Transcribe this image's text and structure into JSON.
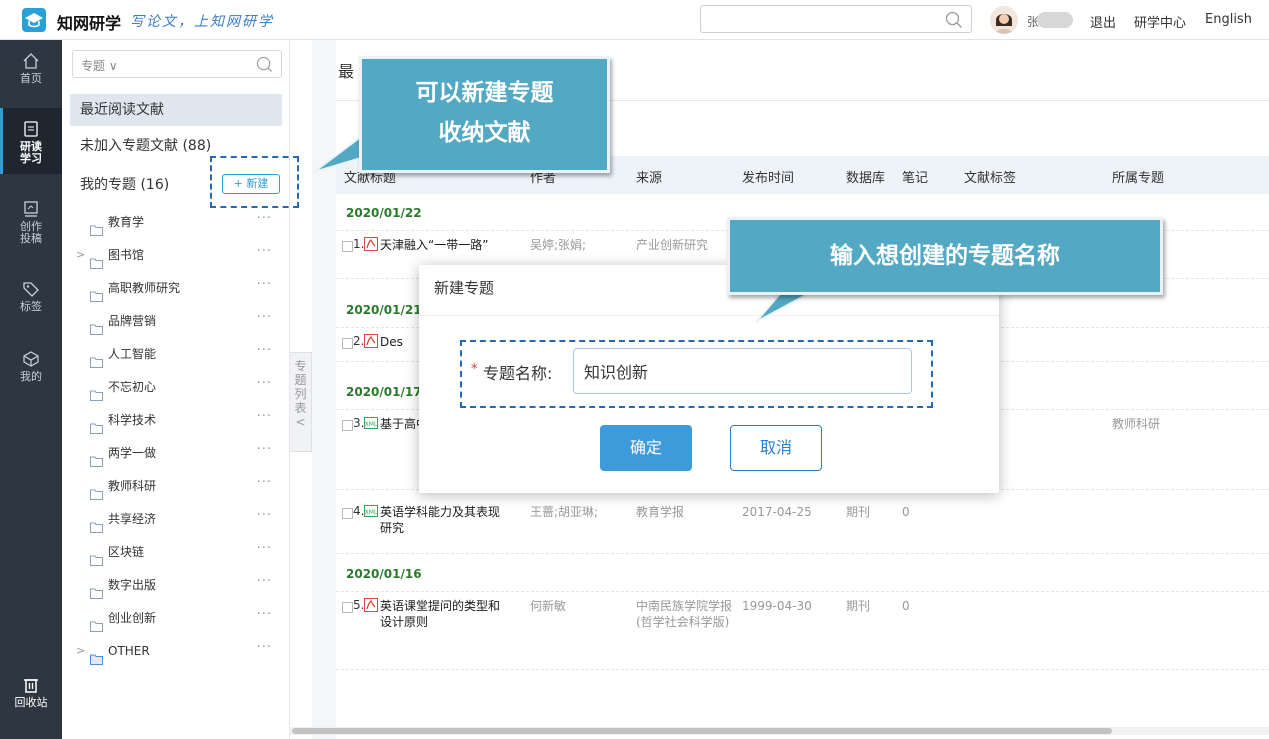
{
  "header": {
    "brand": "知网研学",
    "slogan": "写论文，上知网研学",
    "search_placeholder": "",
    "username": "张",
    "logout": "退出",
    "center": "研学中心",
    "language": "English"
  },
  "iconbar": {
    "items": [
      {
        "label": "首页",
        "icon": "home-icon"
      },
      {
        "label": "研读\n学习",
        "icon": "document-icon"
      },
      {
        "label": "创作\n投稿",
        "icon": "edit-icon"
      },
      {
        "label": "标签",
        "icon": "tag-icon"
      },
      {
        "label": "我的",
        "icon": "cube-icon"
      },
      {
        "label": "回收站",
        "icon": "trash-icon"
      }
    ]
  },
  "sidebar": {
    "search_placeholder": "专题 ∨",
    "recent": "最近阅读文献",
    "unassigned": "未加入专题文献 (88)",
    "my_topics": "我的专题 (16)",
    "new_button": "+ 新建",
    "topics": [
      {
        "label": "教育学",
        "expandable": false
      },
      {
        "label": "图书馆",
        "expandable": true
      },
      {
        "label": "高职教师研究",
        "expandable": false
      },
      {
        "label": "品牌营销",
        "expandable": false
      },
      {
        "label": "人工智能",
        "expandable": false
      },
      {
        "label": "不忘初心",
        "expandable": false
      },
      {
        "label": "科学技术",
        "expandable": false
      },
      {
        "label": "两学一做",
        "expandable": false
      },
      {
        "label": "教师科研",
        "expandable": false
      },
      {
        "label": "共享经济",
        "expandable": false
      },
      {
        "label": "区块链",
        "expandable": false
      },
      {
        "label": "数字出版",
        "expandable": false
      },
      {
        "label": "创业创新",
        "expandable": false
      },
      {
        "label": "OTHER",
        "expandable": true
      }
    ],
    "collapse_tab": "专题列表 <"
  },
  "main": {
    "title": "最",
    "columns": [
      "文献标题",
      "作者",
      "来源",
      "发布时间",
      "数据库",
      "笔记",
      "文献标签",
      "所属专题"
    ],
    "groups": [
      {
        "date": "2020/01/22",
        "rows": [
          {
            "num": "1.",
            "type": "pdf",
            "title": "天津融入“一带一路”",
            "author": "吴婷;张娟;",
            "source": "产业创新研究",
            "date": "",
            "db": "",
            "notes": "",
            "tags": "",
            "topic": ""
          }
        ]
      },
      {
        "date": "2020/01/21",
        "rows": [
          {
            "num": "2.",
            "type": "pdf",
            "title": "Des",
            "author": "",
            "source": "",
            "date": "",
            "db": "",
            "notes": "",
            "tags": "",
            "topic": ""
          }
        ]
      },
      {
        "date": "2020/01/17",
        "rows": [
          {
            "num": "3.",
            "type": "xml",
            "title": "基于高中探究",
            "author": "",
            "source": "",
            "date": "",
            "db": "",
            "notes": "",
            "tags": "",
            "topic": "教师科研"
          },
          {
            "num": "4.",
            "type": "xml",
            "title": "英语学科能力及其表现研究",
            "author": "王蔷;胡亚琳;",
            "source": "教育学报",
            "date": "2017-04-25",
            "db": "期刊",
            "notes": "0",
            "tags": "",
            "topic": ""
          }
        ]
      },
      {
        "date": "2020/01/16",
        "rows": [
          {
            "num": "5.",
            "type": "pdf",
            "title": "英语课堂提问的类型和设计原则",
            "author": "何新敏",
            "source": "中南民族学院学报(哲学社会科学版)",
            "date": "1999-04-30",
            "db": "期刊",
            "notes": "0",
            "tags": "",
            "topic": ""
          }
        ]
      }
    ]
  },
  "modal": {
    "title": "新建专题",
    "required_mark": "*",
    "field_label": "专题名称:",
    "field_value": "知识创新",
    "ok": "确定",
    "cancel": "取消"
  },
  "callouts": {
    "new_topic_line1": "可以新建专题",
    "new_topic_line2": "收纳文献",
    "enter_name": "输入想创建的专题名称"
  },
  "colors": {
    "accent": "#2a9fd8",
    "callout": "#53a8c3",
    "date_green": "#2b7a2b",
    "dash_blue": "#2768b2",
    "iconbar_bg": "#2e3642"
  }
}
